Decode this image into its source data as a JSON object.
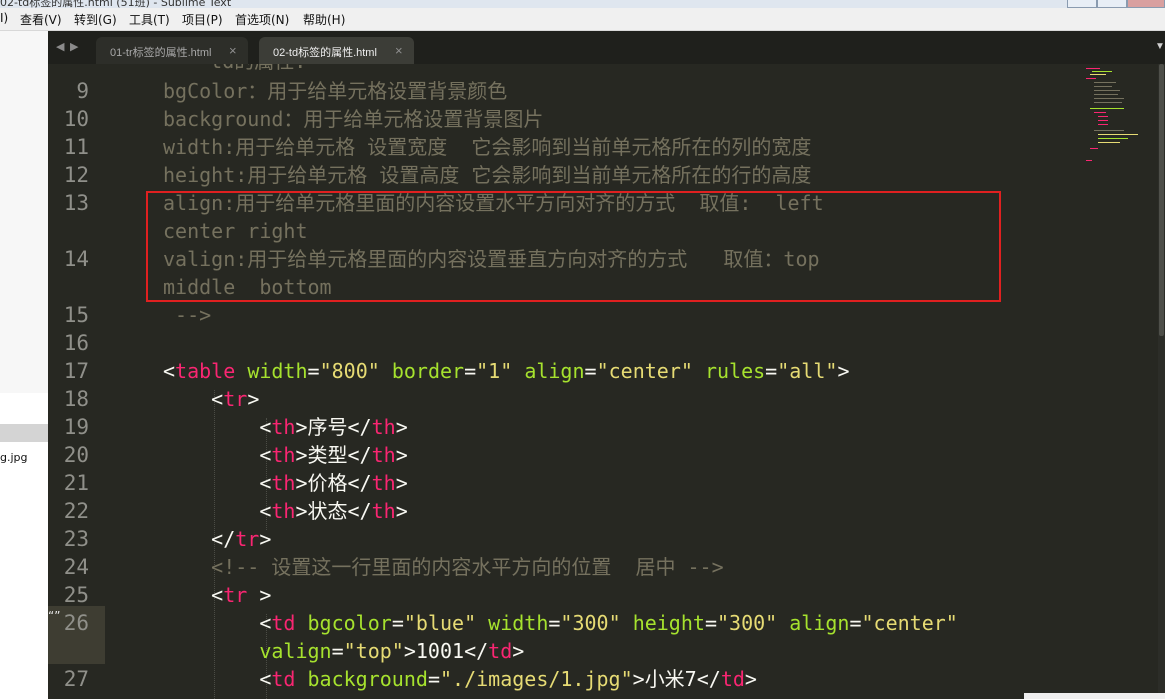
{
  "window": {
    "title": "02-td标签的属性.html (51班) - Sublime Text"
  },
  "menu": [
    "I)",
    "查看(V)",
    "转到(G)",
    "工具(T)",
    "项目(P)",
    "首选项(N)",
    "帮助(H)"
  ],
  "sidebar": {
    "file_fragment": "g.jpg"
  },
  "tabs": [
    {
      "label": "01-tr标签的属性.html",
      "active": false,
      "close": "×"
    },
    {
      "label": "02-td标签的属性.html",
      "active": true,
      "close": "×"
    }
  ],
  "nav": {
    "back": "◀",
    "forward": "▶",
    "tab_menu": "▼"
  },
  "editor": {
    "lines": [
      {
        "n": "9",
        "segments": [
          {
            "c": "cmt",
            "t": "bgColor：用于给单元格设置背景颜色"
          }
        ]
      },
      {
        "n": "10",
        "segments": [
          {
            "c": "cmt",
            "t": "background：用于给单元格设置背景图片"
          }
        ]
      },
      {
        "n": "11",
        "segments": [
          {
            "c": "cmt",
            "t": "width:用于给单元格 设置宽度  它会影响到当前单元格所在的列的宽度"
          }
        ]
      },
      {
        "n": "12",
        "segments": [
          {
            "c": "cmt",
            "t": "height:用于给单元格 设置高度 它会影响到当前单元格所在的行的高度"
          }
        ]
      },
      {
        "n": "13",
        "segments": [
          {
            "c": "cmt",
            "t": "align:用于给单元格里面的内容设置水平方向对齐的方式  取值:  left"
          }
        ]
      },
      {
        "n": "",
        "segments": [
          {
            "c": "cmt",
            "t": "center right"
          }
        ]
      },
      {
        "n": "14",
        "segments": [
          {
            "c": "cmt",
            "t": "valign:用于给单元格里面的内容设置垂直方向对齐的方式   取值：top"
          }
        ]
      },
      {
        "n": "",
        "segments": [
          {
            "c": "cmt",
            "t": "middle  bottom"
          }
        ]
      },
      {
        "n": "15",
        "segments": [
          {
            "c": "cmt",
            "t": " -->"
          }
        ]
      },
      {
        "n": "16",
        "segments": []
      },
      {
        "n": "17",
        "segments": [
          {
            "c": "punc",
            "t": "<"
          },
          {
            "c": "tag",
            "t": "table"
          },
          {
            "c": "punc",
            "t": " "
          },
          {
            "c": "attr",
            "t": "width"
          },
          {
            "c": "punc",
            "t": "="
          },
          {
            "c": "str",
            "t": "\"800\""
          },
          {
            "c": "punc",
            "t": " "
          },
          {
            "c": "attr",
            "t": "border"
          },
          {
            "c": "punc",
            "t": "="
          },
          {
            "c": "str",
            "t": "\"1\""
          },
          {
            "c": "punc",
            "t": " "
          },
          {
            "c": "attr",
            "t": "align"
          },
          {
            "c": "punc",
            "t": "="
          },
          {
            "c": "str",
            "t": "\"center\""
          },
          {
            "c": "punc",
            "t": " "
          },
          {
            "c": "attr",
            "t": "rules"
          },
          {
            "c": "punc",
            "t": "="
          },
          {
            "c": "str",
            "t": "\"all\""
          },
          {
            "c": "punc",
            "t": ">"
          }
        ]
      },
      {
        "n": "18",
        "segments": [
          {
            "c": "punc",
            "t": "    <"
          },
          {
            "c": "tag",
            "t": "tr"
          },
          {
            "c": "punc",
            "t": ">"
          }
        ]
      },
      {
        "n": "19",
        "segments": [
          {
            "c": "punc",
            "t": "        <"
          },
          {
            "c": "tag",
            "t": "th"
          },
          {
            "c": "punc",
            "t": ">"
          },
          {
            "c": "txt",
            "t": "序号"
          },
          {
            "c": "punc",
            "t": "</"
          },
          {
            "c": "tag",
            "t": "th"
          },
          {
            "c": "punc",
            "t": ">"
          }
        ]
      },
      {
        "n": "20",
        "segments": [
          {
            "c": "punc",
            "t": "        <"
          },
          {
            "c": "tag",
            "t": "th"
          },
          {
            "c": "punc",
            "t": ">"
          },
          {
            "c": "txt",
            "t": "类型"
          },
          {
            "c": "punc",
            "t": "</"
          },
          {
            "c": "tag",
            "t": "th"
          },
          {
            "c": "punc",
            "t": ">"
          }
        ]
      },
      {
        "n": "21",
        "segments": [
          {
            "c": "punc",
            "t": "        <"
          },
          {
            "c": "tag",
            "t": "th"
          },
          {
            "c": "punc",
            "t": ">"
          },
          {
            "c": "txt",
            "t": "价格"
          },
          {
            "c": "punc",
            "t": "</"
          },
          {
            "c": "tag",
            "t": "th"
          },
          {
            "c": "punc",
            "t": ">"
          }
        ]
      },
      {
        "n": "22",
        "segments": [
          {
            "c": "punc",
            "t": "        <"
          },
          {
            "c": "tag",
            "t": "th"
          },
          {
            "c": "punc",
            "t": ">"
          },
          {
            "c": "txt",
            "t": "状态"
          },
          {
            "c": "punc",
            "t": "</"
          },
          {
            "c": "tag",
            "t": "th"
          },
          {
            "c": "punc",
            "t": ">"
          }
        ]
      },
      {
        "n": "23",
        "segments": [
          {
            "c": "punc",
            "t": "    </"
          },
          {
            "c": "tag",
            "t": "tr"
          },
          {
            "c": "punc",
            "t": ">"
          }
        ]
      },
      {
        "n": "24",
        "segments": [
          {
            "c": "cmt",
            "t": "    <!-- 设置这一行里面的内容水平方向的位置  居中 -->"
          }
        ]
      },
      {
        "n": "25",
        "segments": [
          {
            "c": "punc",
            "t": "    <"
          },
          {
            "c": "tag",
            "t": "tr"
          },
          {
            "c": "punc",
            "t": " >"
          }
        ]
      },
      {
        "n": "26",
        "segments": [
          {
            "c": "punc",
            "t": "        <"
          },
          {
            "c": "tag",
            "t": "td"
          },
          {
            "c": "punc",
            "t": " "
          },
          {
            "c": "attr",
            "t": "bgcolor"
          },
          {
            "c": "punc",
            "t": "="
          },
          {
            "c": "str",
            "t": "\"blue\""
          },
          {
            "c": "punc",
            "t": " "
          },
          {
            "c": "attr",
            "t": "width"
          },
          {
            "c": "punc",
            "t": "="
          },
          {
            "c": "str",
            "t": "\"300\""
          },
          {
            "c": "punc",
            "t": " "
          },
          {
            "c": "attr",
            "t": "height"
          },
          {
            "c": "punc",
            "t": "="
          },
          {
            "c": "str",
            "t": "\"300\""
          },
          {
            "c": "punc",
            "t": " "
          },
          {
            "c": "attr",
            "t": "align"
          },
          {
            "c": "punc",
            "t": "="
          },
          {
            "c": "str",
            "t": "\"center\""
          }
        ]
      },
      {
        "n": "",
        "segments": [
          {
            "c": "punc",
            "t": "        "
          },
          {
            "c": "attr",
            "t": "valign"
          },
          {
            "c": "punc",
            "t": "="
          },
          {
            "c": "str",
            "t": "\"top\""
          },
          {
            "c": "punc",
            "t": ">"
          },
          {
            "c": "txt",
            "t": "1001"
          },
          {
            "c": "punc",
            "t": "</"
          },
          {
            "c": "tag",
            "t": "td"
          },
          {
            "c": "punc",
            "t": ">"
          }
        ]
      },
      {
        "n": "27",
        "segments": [
          {
            "c": "punc",
            "t": "        <"
          },
          {
            "c": "tag",
            "t": "td"
          },
          {
            "c": "punc",
            "t": " "
          },
          {
            "c": "attr",
            "t": "background"
          },
          {
            "c": "punc",
            "t": "="
          },
          {
            "c": "str",
            "t": "\"./images/1.jpg\""
          },
          {
            "c": "punc",
            "t": ">"
          },
          {
            "c": "txt",
            "t": "小米7"
          },
          {
            "c": "punc",
            "t": "</"
          },
          {
            "c": "tag",
            "t": "td"
          },
          {
            "c": "punc",
            "t": ">"
          }
        ]
      }
    ],
    "gutter_marker": "“”"
  },
  "colors": {
    "background": "#272822",
    "comment": "#75715e",
    "tag": "#f92672",
    "attribute": "#a6e22e",
    "string": "#e6db74",
    "text": "#f8f8f2",
    "annotation_box": "#e02020"
  }
}
